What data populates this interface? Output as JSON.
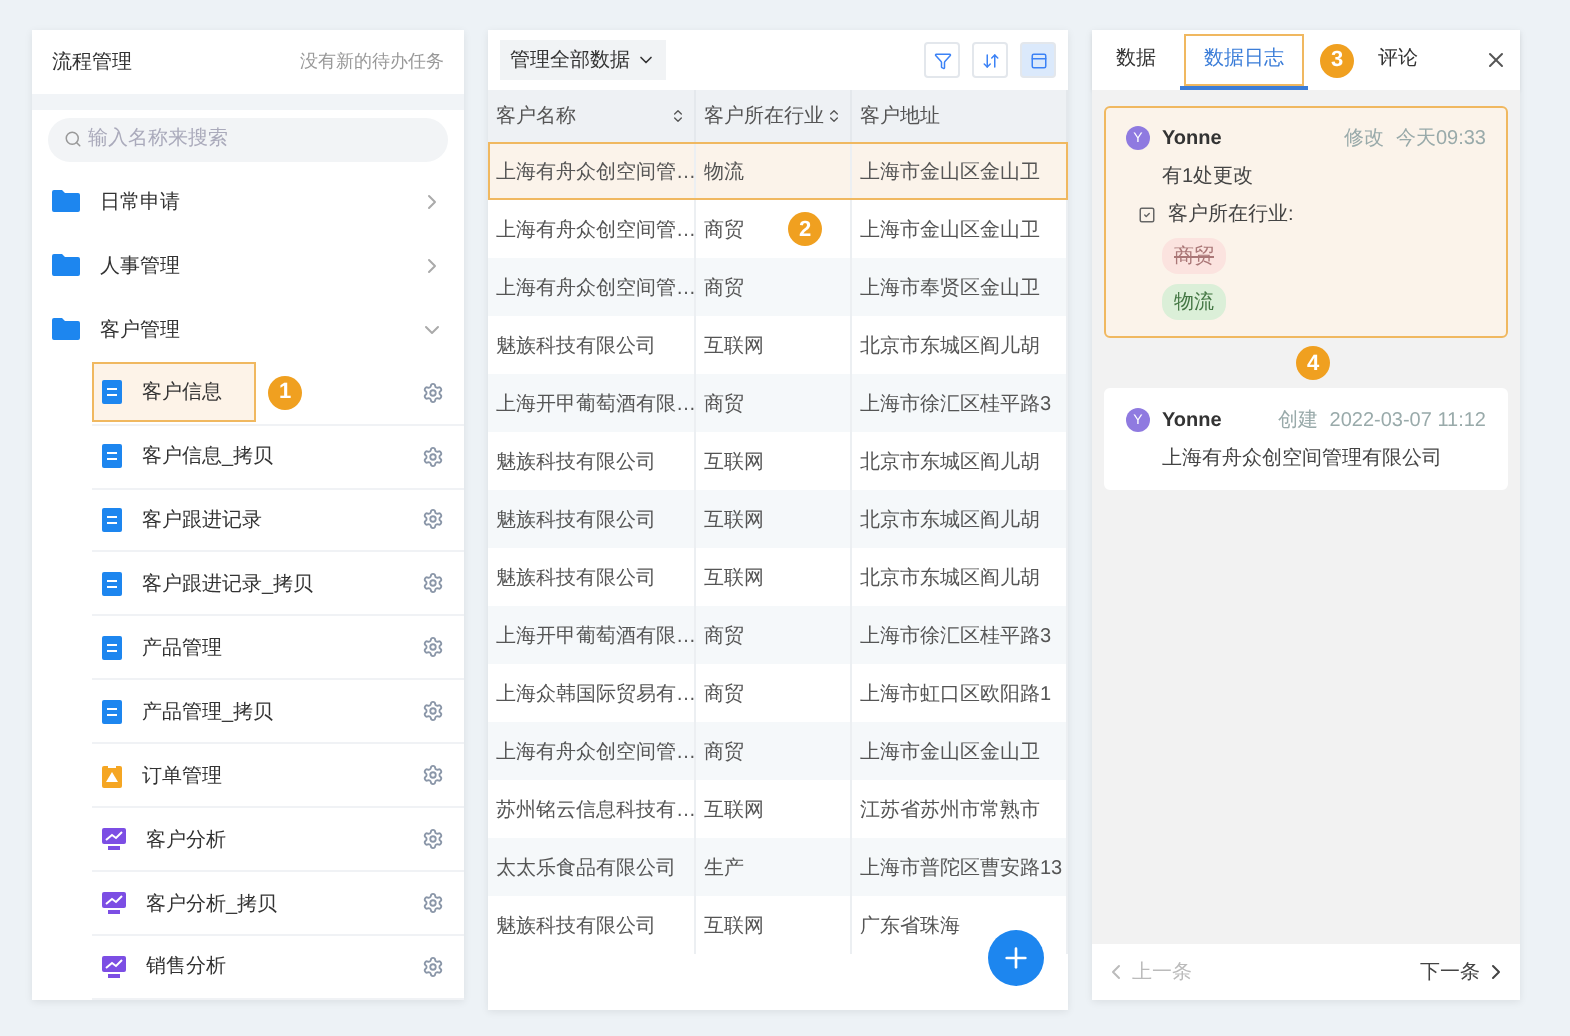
{
  "left_panel": {
    "title": "流程管理",
    "notice": "没有新的待办任务",
    "search": {
      "placeholder": "输入名称来搜索"
    },
    "tree": [
      {
        "label": "日常申请",
        "kind": "folder",
        "expanded": false
      },
      {
        "label": "人事管理",
        "kind": "folder",
        "expanded": false
      },
      {
        "label": "客户管理",
        "kind": "folder",
        "expanded": true,
        "children": [
          {
            "label": "客户信息",
            "kind": "form",
            "selected": true,
            "callout": "1"
          },
          {
            "label": "客户信息_拷贝",
            "kind": "form",
            "selected": false
          },
          {
            "label": "客户跟进记录",
            "kind": "form",
            "selected": false
          },
          {
            "label": "客户跟进记录_拷贝",
            "kind": "form",
            "selected": false
          },
          {
            "label": "产品管理",
            "kind": "form",
            "selected": false
          },
          {
            "label": "产品管理_拷贝",
            "kind": "form",
            "selected": false
          },
          {
            "label": "订单管理",
            "kind": "task",
            "selected": false
          },
          {
            "label": "客户分析",
            "kind": "chart",
            "selected": false
          },
          {
            "label": "客户分析_拷贝",
            "kind": "chart",
            "selected": false
          },
          {
            "label": "销售分析",
            "kind": "chart",
            "selected": false
          }
        ]
      }
    ]
  },
  "middle_panel": {
    "scope_dropdown": "管理全部数据",
    "tools": [
      {
        "kind": "filter",
        "selected": false
      },
      {
        "kind": "sort",
        "selected": false
      },
      {
        "kind": "view",
        "selected": true
      }
    ],
    "table": {
      "columns": [
        {
          "label": "客户名称",
          "sortable": true
        },
        {
          "label": "客户所在行业",
          "sortable": true
        },
        {
          "label": "客户地址",
          "sortable": false
        }
      ],
      "rows": [
        {
          "cells": [
            "上海有舟众创空间管…",
            "物流",
            "上海市金山区金山卫"
          ],
          "selected": true
        },
        {
          "cells": [
            "上海有舟众创空间管…",
            "商贸",
            "上海市金山区金山卫"
          ],
          "selected": false,
          "callout": "2"
        },
        {
          "cells": [
            "上海有舟众创空间管…",
            "商贸",
            "上海市奉贤区金山卫"
          ],
          "selected": false
        },
        {
          "cells": [
            "魅族科技有限公司",
            "互联网",
            "北京市东城区阎儿胡"
          ],
          "selected": false
        },
        {
          "cells": [
            "上海开甲葡萄酒有限…",
            "商贸",
            "上海市徐汇区桂平路3"
          ],
          "selected": false
        },
        {
          "cells": [
            "魅族科技有限公司",
            "互联网",
            "北京市东城区阎儿胡"
          ],
          "selected": false
        },
        {
          "cells": [
            "魅族科技有限公司",
            "互联网",
            "北京市东城区阎儿胡"
          ],
          "selected": false
        },
        {
          "cells": [
            "魅族科技有限公司",
            "互联网",
            "北京市东城区阎儿胡"
          ],
          "selected": false
        },
        {
          "cells": [
            "上海开甲葡萄酒有限…",
            "商贸",
            "上海市徐汇区桂平路3"
          ],
          "selected": false
        },
        {
          "cells": [
            "上海众韩国际贸易有…",
            "商贸",
            "上海市虹口区欧阳路1"
          ],
          "selected": false
        },
        {
          "cells": [
            "上海有舟众创空间管…",
            "商贸",
            "上海市金山区金山卫"
          ],
          "selected": false
        },
        {
          "cells": [
            "苏州铭云信息科技有…",
            "互联网",
            "江苏省苏州市常熟市"
          ],
          "selected": false
        },
        {
          "cells": [
            "太太乐食品有限公司",
            "生产",
            "上海市普陀区曹安路13"
          ],
          "selected": false
        },
        {
          "cells": [
            "魅族科技有限公司",
            "互联网",
            "广东省珠海"
          ],
          "selected": false
        }
      ]
    }
  },
  "right_panel": {
    "tabs": [
      {
        "label": "数据",
        "selected": false
      },
      {
        "label": "数据日志",
        "selected": true,
        "callout": "3"
      },
      {
        "label": "评论",
        "selected": false
      }
    ],
    "log": [
      {
        "user": "Yonne",
        "avatar": "Y",
        "action": "修改",
        "time": "今天09:33",
        "selected": true,
        "summary": "有1处更改",
        "field": "客户所在行业:",
        "changes": [
          {
            "value": "商贸",
            "kind": "removed"
          },
          {
            "value": "物流",
            "kind": "added"
          }
        ]
      },
      {
        "user": "Yonne",
        "avatar": "Y",
        "action": "创建",
        "time": "2022-03-07 11:12",
        "selected": false,
        "callout": "4",
        "text": "上海有舟众创空间管理有限公司"
      }
    ],
    "footer": {
      "prev": {
        "label": "上一条",
        "disabled": true
      },
      "next": {
        "label": "下一条",
        "disabled": false
      }
    }
  }
}
